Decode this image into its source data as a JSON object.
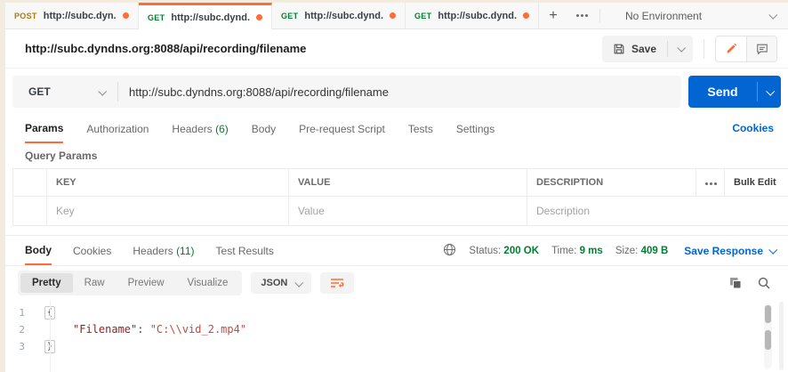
{
  "colors": {
    "accent_orange": "#ff6c37",
    "get_green": "#007f31",
    "post_amber": "#ad7a03",
    "link_blue": "#0265d2",
    "send_blue": "#0265d2",
    "json_key": "#8a2426",
    "json_string": "#bf4a41"
  },
  "tabbar": {
    "tabs": [
      {
        "method": "POST",
        "title": "http://subc.dyn..."
      },
      {
        "method": "GET",
        "title": "http://subc.dynd..."
      },
      {
        "method": "GET",
        "title": "http://subc.dynd..."
      },
      {
        "method": "GET",
        "title": "http://subc.dynd..."
      }
    ],
    "new_tab_label": "+",
    "environment": "No Environment"
  },
  "request": {
    "title": "http://subc.dyndns.org:8088/api/recording/filename",
    "save_label": "Save",
    "method": "GET",
    "url": "http://subc.dyndns.org:8088/api/recording/filename",
    "send_label": "Send",
    "tabs": [
      {
        "label": "Params"
      },
      {
        "label": "Authorization"
      },
      {
        "label": "Headers",
        "count": "(6)"
      },
      {
        "label": "Body"
      },
      {
        "label": "Pre-request Script"
      },
      {
        "label": "Tests"
      },
      {
        "label": "Settings"
      }
    ],
    "cookies_link": "Cookies"
  },
  "query_params": {
    "section_title": "Query Params",
    "headers": {
      "key": "KEY",
      "value": "VALUE",
      "description": "DESCRIPTION"
    },
    "bulk_edit_label": "Bulk Edit",
    "row_placeholders": {
      "key": "Key",
      "value": "Value",
      "description": "Description"
    }
  },
  "response": {
    "tabs": [
      {
        "label": "Body"
      },
      {
        "label": "Cookies"
      },
      {
        "label": "Headers",
        "count": "(11)"
      },
      {
        "label": "Test Results"
      }
    ],
    "status_label": "Status:",
    "status_value": "200 OK",
    "time_label": "Time:",
    "time_value": "9 ms",
    "size_label": "Size:",
    "size_value": "409 B",
    "save_response_label": "Save Response",
    "views": [
      "Pretty",
      "Raw",
      "Preview",
      "Visualize"
    ],
    "format": "JSON",
    "body": {
      "line_numbers": [
        "1",
        "2",
        "3"
      ],
      "line1": "{",
      "line2_key": "\"Filename\"",
      "line2_colon": ": ",
      "line2_value": "\"C:\\\\vid_2.mp4\"",
      "line3": "}"
    }
  }
}
